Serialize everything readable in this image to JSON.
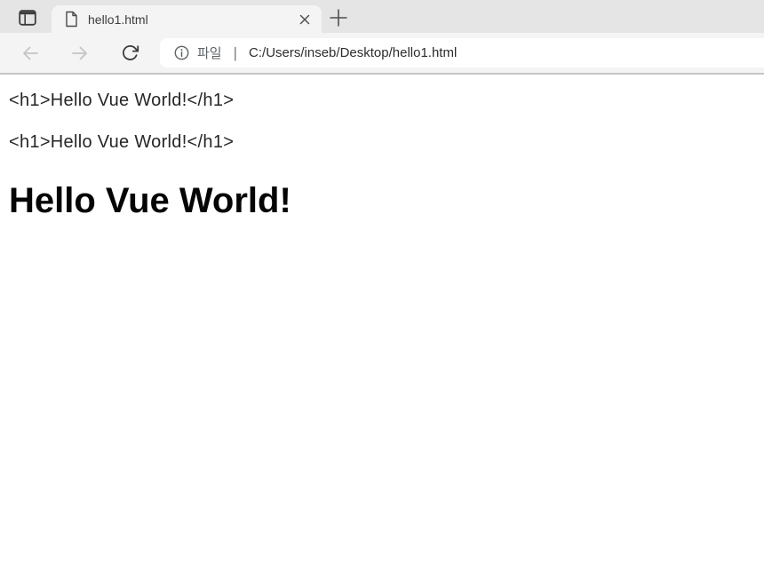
{
  "tab_bar": {
    "active_tab": {
      "title": "hello1.html"
    }
  },
  "toolbar": {
    "address": {
      "scheme_label": "파일",
      "separator": "|",
      "url": "C:/Users/inseb/Desktop/hello1.html"
    }
  },
  "page": {
    "line1": "<h1>Hello Vue World!</h1>",
    "line2": "<h1>Hello Vue World!</h1>",
    "heading": "Hello Vue World!"
  },
  "icons": {
    "tab_actions": "window-layout-icon",
    "tab_file": "document-icon",
    "tab_close": "close-icon",
    "new_tab": "plus-icon",
    "back": "arrow-left-icon",
    "forward": "arrow-right-icon",
    "reload": "refresh-icon",
    "site_info": "info-icon"
  },
  "colors": {
    "tab_bar_bg": "#e5e5e5",
    "chrome_bg": "#f4f4f4",
    "address_bar_bg": "#ffffff",
    "chrome_border": "#c6c6c6",
    "url_text": "#2d2d2d",
    "secondary_text": "#5f6368",
    "disabled_icon": "#c4c4c4",
    "icon": "#3c3c3c",
    "page_text": "#262626"
  }
}
